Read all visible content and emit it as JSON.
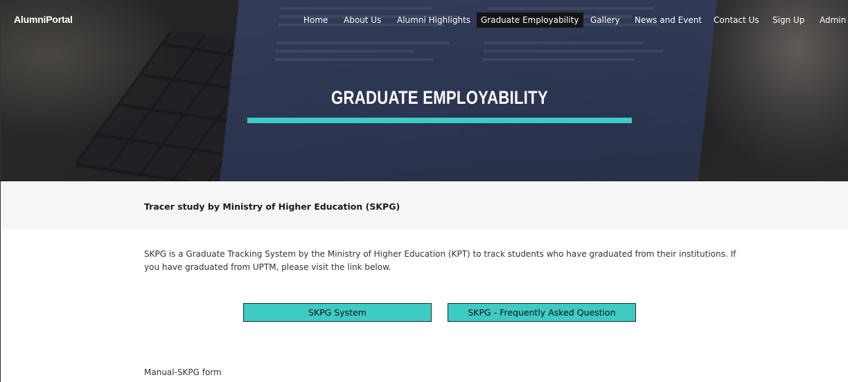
{
  "brand": "AlumniPortal",
  "nav": {
    "items": [
      {
        "label": "Home"
      },
      {
        "label": "About Us"
      },
      {
        "label": "Alumni Highlights"
      },
      {
        "label": "Graduate Employability",
        "active": true
      },
      {
        "label": "Gallery"
      },
      {
        "label": "News and Event"
      },
      {
        "label": "Contact Us"
      },
      {
        "label": "Sign Up"
      },
      {
        "label": "Admin"
      }
    ]
  },
  "hero": {
    "title": "GRADUATE EMPLOYABILITY",
    "accent_color": "#3ecbc3"
  },
  "section": {
    "title": "Tracer study by Ministry of Higher Education (SKPG)",
    "description": "SKPG is a Graduate Tracking System by the Ministry of Higher Education (KPT) to track students who have graduated from their institutions. If you have graduated from UPTM, please visit the link below.",
    "buttons": {
      "system": "SKPG System",
      "faq": "SKPG - Frequently Asked Question"
    },
    "manual_form": "Manual-SKPG form"
  }
}
